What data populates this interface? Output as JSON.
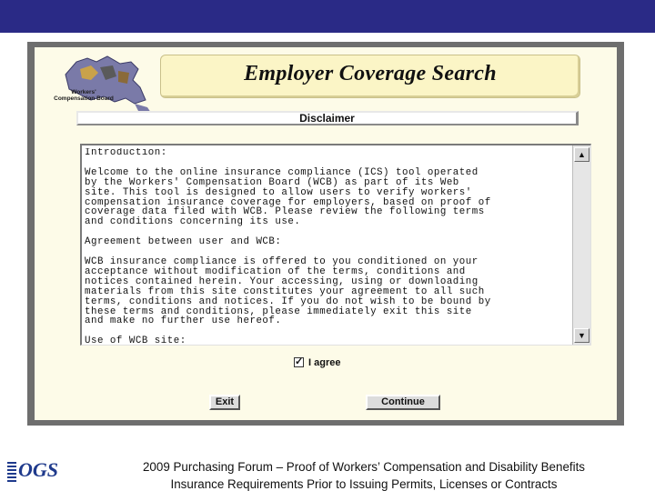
{
  "app": {
    "title": "Employer Coverage Search",
    "logo_text": "Workers' Compensation Board",
    "disclaimer_heading": "Disclaimer"
  },
  "disclaimer_text": [
    "Introduction:",
    "",
    "Welcome to the online insurance compliance (ICS) tool operated",
    "by the Workers' Compensation Board (WCB) as part of its Web",
    "site. This tool is designed to allow users to verify workers'",
    "compensation insurance coverage for employers, based on proof of",
    "coverage data filed with WCB. Please review the following terms",
    "and conditions concerning its use.",
    "",
    "Agreement between user and WCB:",
    "",
    "WCB insurance compliance is offered to you conditioned on your",
    "acceptance without modification of the terms, conditions and",
    "notices contained herein. Your accessing, using or downloading",
    "materials from this site constitutes your agreement to all such",
    "terms, conditions and notices. If you do not wish to be bound by",
    "these terms and conditions, please immediately exit this site",
    "and make no further use hereof.",
    "",
    "Use of WCB site:"
  ],
  "agree": {
    "label": "I agree",
    "checked": true
  },
  "buttons": {
    "exit": "Exit",
    "continue": "Continue"
  },
  "footer": {
    "line1": "2009 Purchasing Forum – Proof of Workers’ Compensation and Disability Benefits",
    "line2": "Insurance Requirements Prior to Issuing Permits, Licenses or Contracts",
    "logo_text": "OGS"
  },
  "colors": {
    "top_band": "#2a2a86",
    "app_background": "#fdfbe8",
    "frame": "#6e6e6e",
    "logo_blue": "#1f3a8c"
  },
  "icons": {
    "scroll_up": "arrow-up-icon",
    "scroll_down": "arrow-down-icon",
    "check": "checkmark-icon"
  }
}
